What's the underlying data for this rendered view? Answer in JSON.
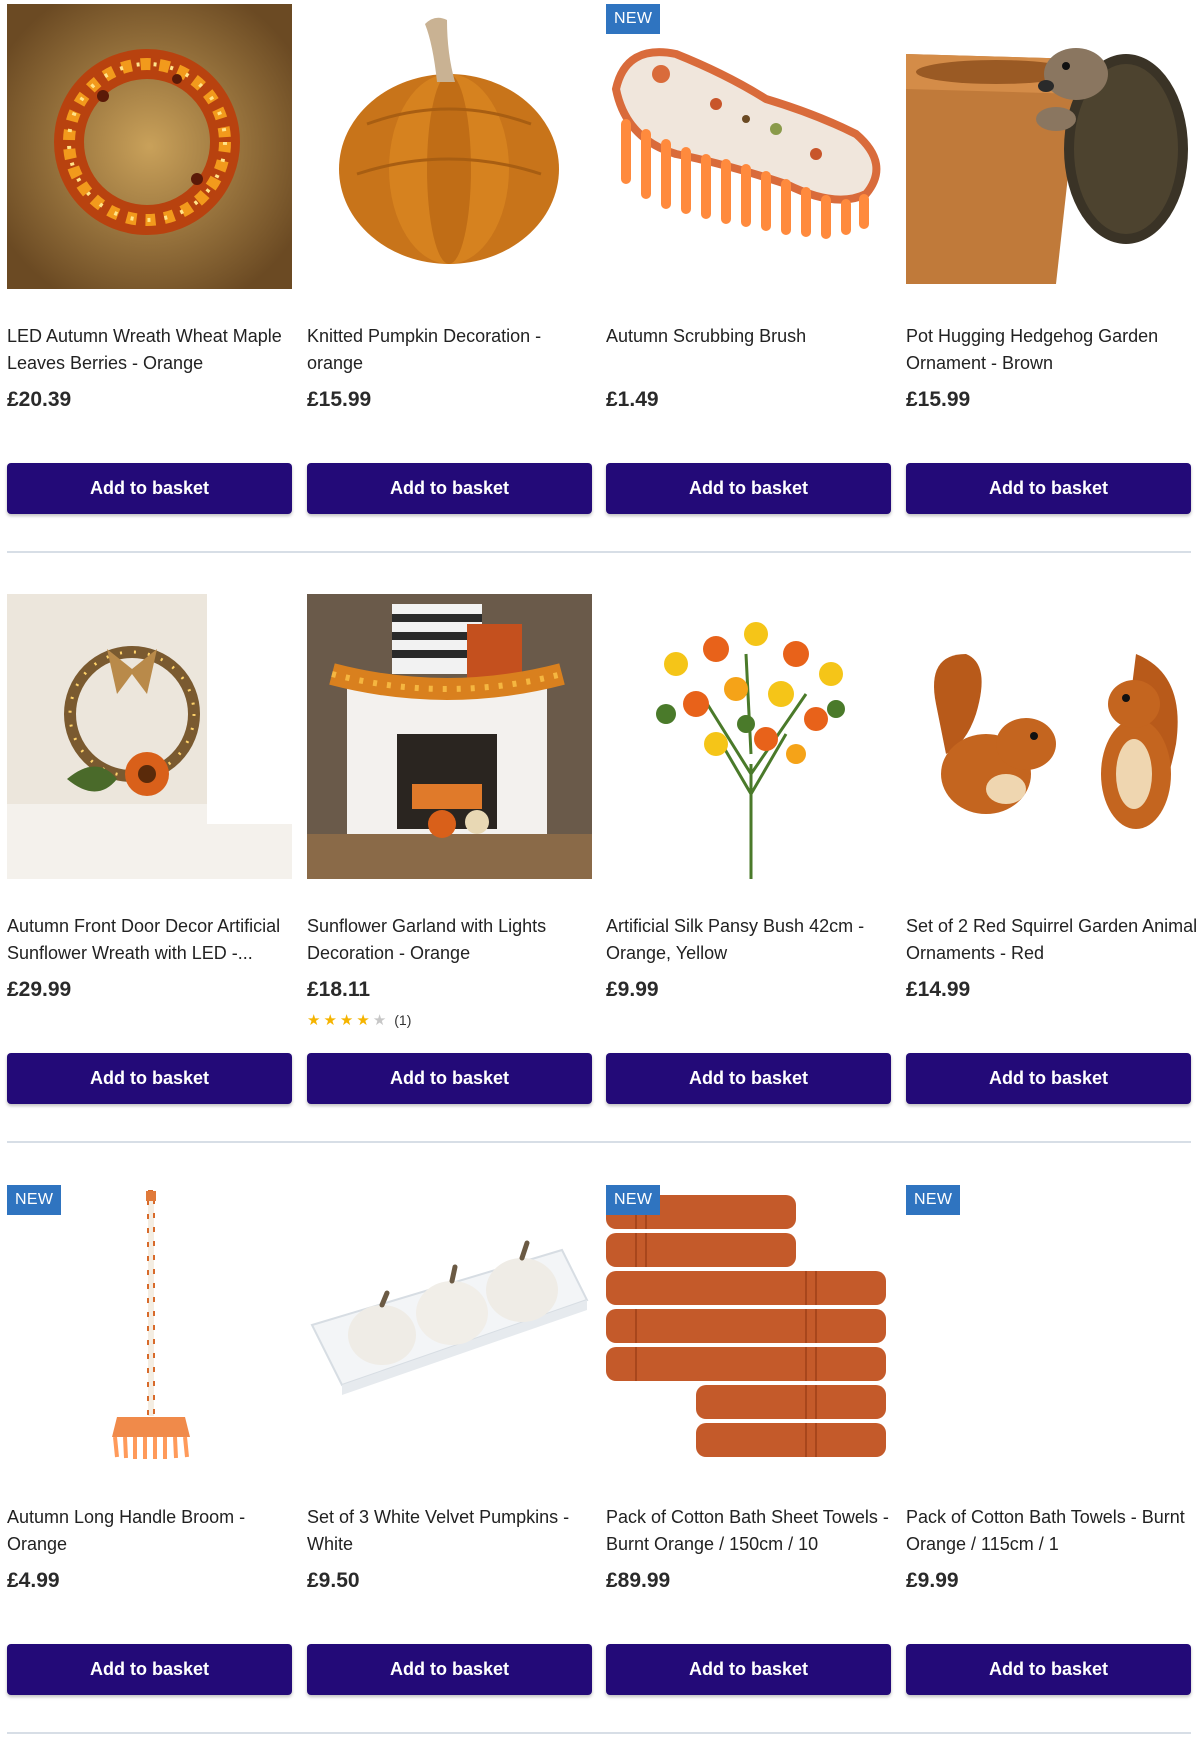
{
  "colors": {
    "button_bg": "#230a78",
    "badge_bg": "#2f74c0",
    "separator": "#d7dee6"
  },
  "products": [
    {
      "title": "LED Autumn Wreath Wheat Maple\nLeaves Berries - Orange",
      "price": "£20.39",
      "button": "Add to basket",
      "badge": "",
      "image": "led-wreath-image"
    },
    {
      "title": "Knitted Pumpkin Decoration -\norange",
      "price": "£15.99",
      "button": "Add to basket",
      "badge": "",
      "image": "knitted-pumpkin-image"
    },
    {
      "title": "Autumn Scrubbing Brush",
      "price": "£1.49",
      "button": "Add to basket",
      "badge": "NEW",
      "image": "scrubbing-brush-image"
    },
    {
      "title": "Pot Hugging Hedgehog Garden\nOrnament - Brown",
      "price": "£15.99",
      "button": "Add to basket",
      "badge": "",
      "image": "hedgehog-image"
    },
    {
      "title": "Autumn Front Door Decor Artificial\nSunflower Wreath with LED -...",
      "price": "£29.99",
      "button": "Add to basket",
      "badge": "",
      "image": "sunflower-wreath-image"
    },
    {
      "title": "Sunflower Garland with Lights\nDecoration - Orange",
      "price": "£18.11",
      "button": "Add to basket",
      "badge": "",
      "image": "garland-image",
      "rating": {
        "stars": 4,
        "out_of": 5,
        "count": "(1)"
      }
    },
    {
      "title": "Artificial Silk Pansy Bush 42cm -\nOrange, Yellow",
      "price": "£9.99",
      "button": "Add to basket",
      "badge": "",
      "image": "pansy-bush-image"
    },
    {
      "title": "Set of 2 Red Squirrel Garden Animal\nOrnaments - Red",
      "price": "£14.99",
      "button": "Add to basket",
      "badge": "",
      "image": "squirrels-image"
    },
    {
      "title": "Autumn Long Handle Broom -\nOrange",
      "price": "£4.99",
      "button": "Add to basket",
      "badge": "NEW",
      "image": "broom-image"
    },
    {
      "title": "Set of 3 White Velvet Pumpkins -\nWhite",
      "price": "£9.50",
      "button": "Add to basket",
      "badge": "",
      "image": "white-pumpkins-image"
    },
    {
      "title": "Pack of Cotton Bath Sheet Towels -\nBurnt Orange / 150cm / 10",
      "price": "£89.99",
      "button": "Add to basket",
      "badge": "NEW",
      "image": "bath-sheets-image"
    },
    {
      "title": "Pack of Cotton Bath Towels - Burnt\nOrange / 115cm / 1",
      "price": "£9.99",
      "button": "Add to basket",
      "badge": "NEW",
      "image": "bath-towels-image"
    }
  ]
}
